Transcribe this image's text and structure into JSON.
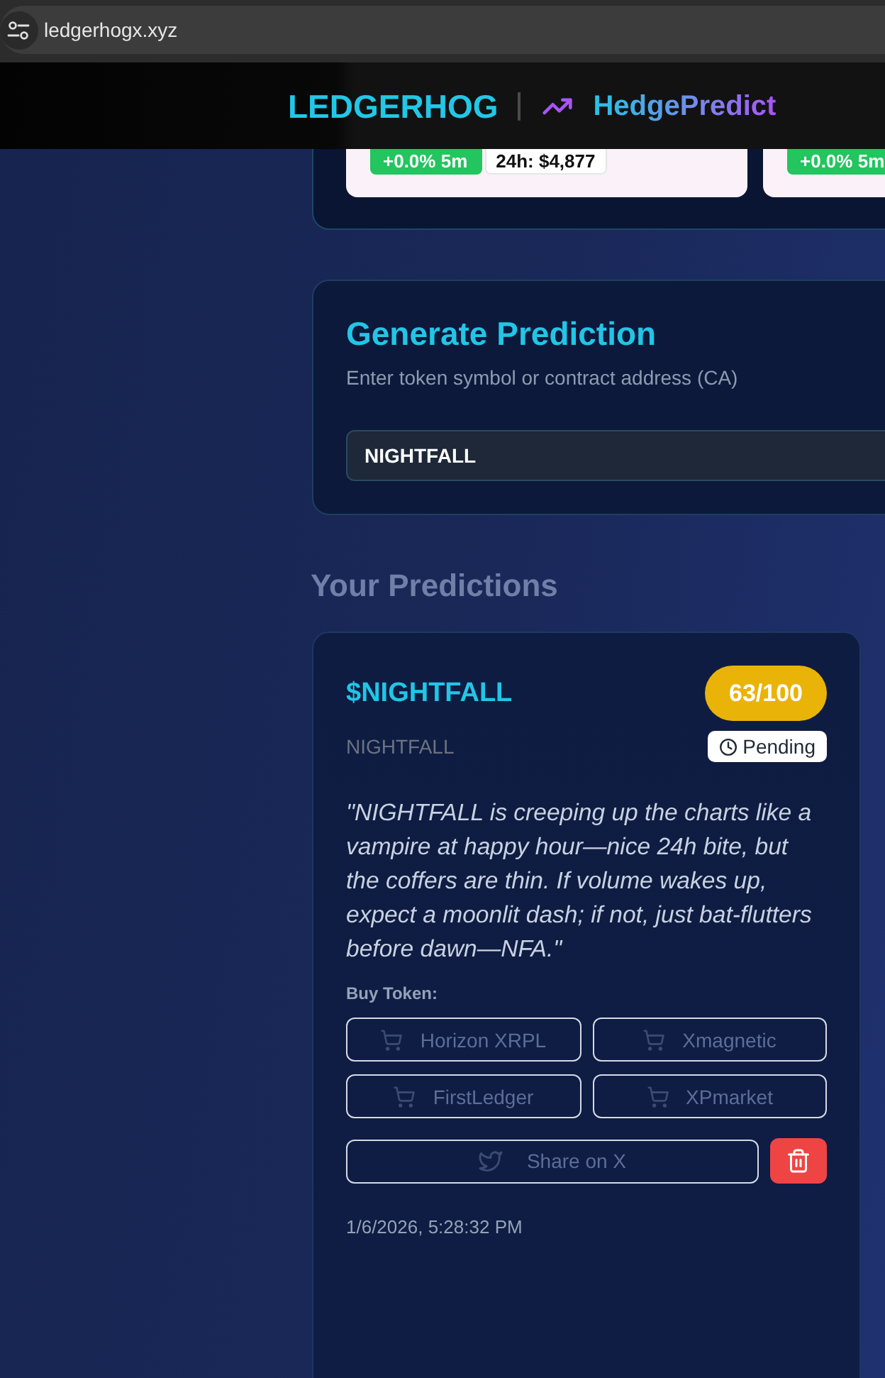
{
  "browser": {
    "url": "ledgerhogx.xyz"
  },
  "header": {
    "brand": "LEDGERHOG",
    "app_name": "HedgePredict"
  },
  "token_cards": [
    {
      "change": "+0.0% 5m",
      "volume": "24h: $4,877"
    },
    {
      "change": "+0.0% 5m"
    }
  ],
  "generate": {
    "title": "Generate Prediction",
    "subtitle": "Enter token symbol or contract address (CA)",
    "input_value": "NIGHTFALL"
  },
  "predictions_title": "Your Predictions",
  "predictions": [
    {
      "symbol": "$NIGHTFALL",
      "name": "NIGHTFALL",
      "score": "63/100",
      "status": {
        "kind": "pending",
        "label": "Pending"
      },
      "quote": "\"NIGHTFALL is creeping up the charts like a vampire at happy hour—nice 24h bite, but the coffers are thin. If volume wakes up, expect a moonlit dash; if not, just bat-flutters before dawn—NFA.\"",
      "buy_label": "Buy Token:",
      "buy_links": [
        {
          "label": "Horizon XRPL"
        },
        {
          "label": "Xmagnetic"
        },
        {
          "label": "FirstLedger"
        },
        {
          "label": "XPmarket"
        }
      ],
      "share_label": "Share on X",
      "timestamp": "1/6/2026, 5:28:32 PM"
    }
  ]
}
